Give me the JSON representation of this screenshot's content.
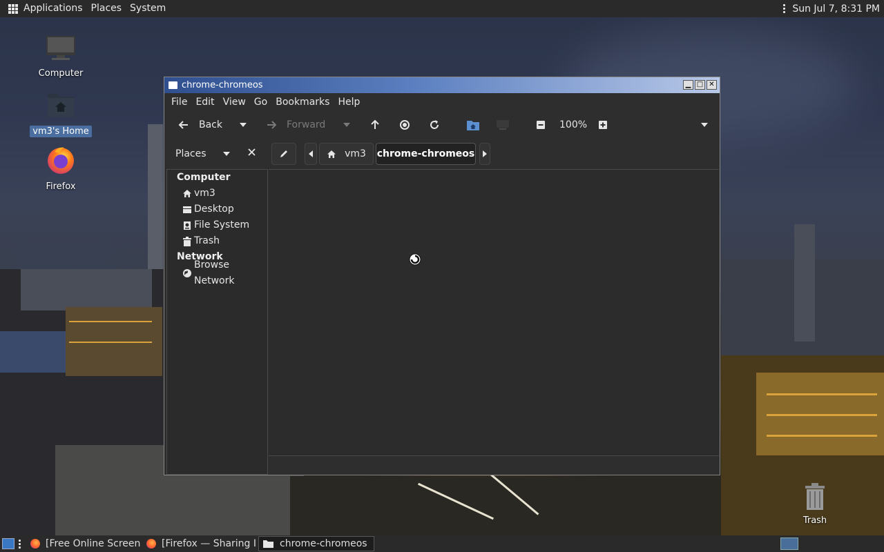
{
  "top_panel": {
    "applications": "Applications",
    "places": "Places",
    "system": "System",
    "clock": "Sun Jul 7, 8:31 PM"
  },
  "desktop": {
    "icons": [
      {
        "label": "Computer"
      },
      {
        "label": "vm3's Home"
      },
      {
        "label": "Firefox"
      },
      {
        "label": "Trash"
      }
    ]
  },
  "window": {
    "title": "chrome-chromeos",
    "menu": [
      "File",
      "Edit",
      "View",
      "Go",
      "Bookmarks",
      "Help"
    ],
    "toolbar": {
      "back": "Back",
      "forward": "Forward",
      "zoom": "100%"
    },
    "places_label": "Places",
    "breadcrumb": [
      "vm3",
      "chrome-chromeos"
    ],
    "sidebar": {
      "computer_header": "Computer",
      "computer_items": [
        "vm3",
        "Desktop",
        "File System",
        "Trash"
      ],
      "network_header": "Network",
      "network_items": [
        "Browse Network"
      ]
    }
  },
  "taskbar": {
    "tasks": [
      {
        "label": "[Free Online Screen ..."
      },
      {
        "label": "[Firefox — Sharing I..."
      },
      {
        "label": "chrome-chromeos"
      }
    ]
  },
  "colors": {
    "titlebar_start": "#2f4f8f",
    "titlebar_end": "#b8c8e8",
    "panel": "#2a2a2a",
    "selection": "#4a6ea0"
  }
}
